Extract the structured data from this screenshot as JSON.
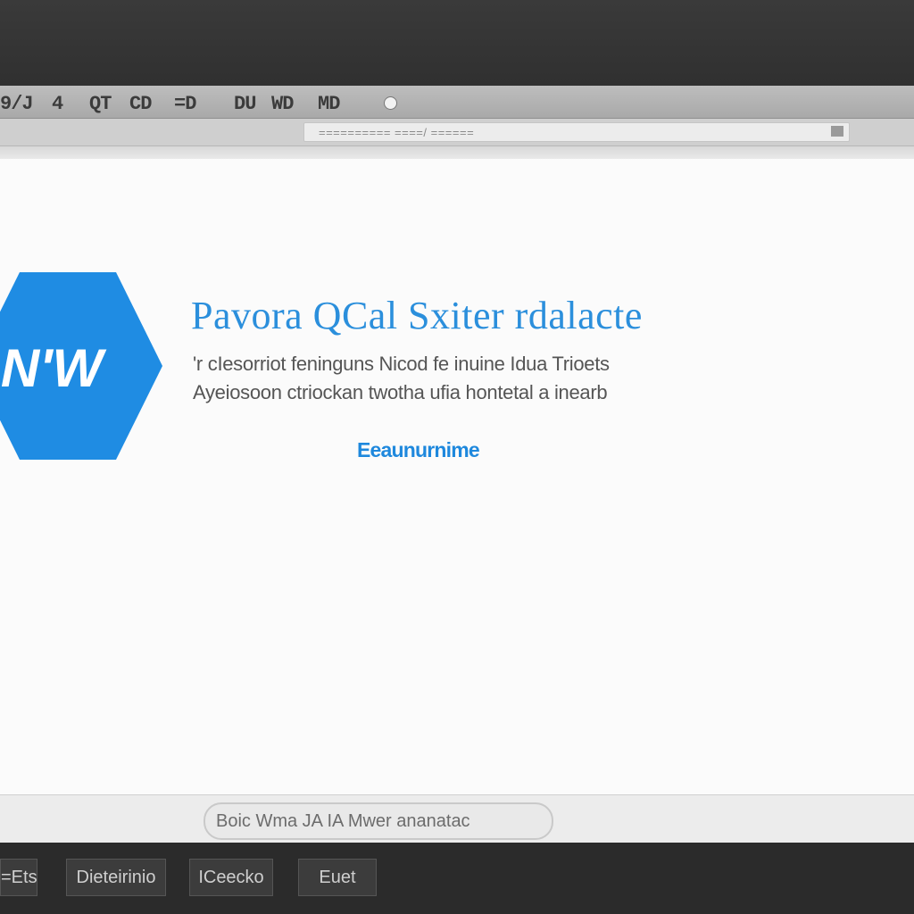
{
  "menubar": {
    "items": [
      "9/J",
      "4",
      "QT",
      "CD",
      "=D",
      "DU",
      "WD",
      "MD"
    ]
  },
  "address": {
    "text": "==========  ====/  ======"
  },
  "product": {
    "title": "Pavora QCal Sxiter rdalacte",
    "desc_line1": "'r cIesorriot feninguns Nicod fe inuine Idua Trioets",
    "desc_line2": "Ayeiosoon ctriockan twotha ufia hontetal a inearb",
    "link": "Eeaunurnime"
  },
  "status": {
    "text": "Boic  Wma JA  IA  Mwer ananatac"
  },
  "taskbar": {
    "buttons": [
      "=Ets",
      "Dieteirinio",
      "ICeecko",
      "Euet"
    ]
  },
  "colors": {
    "accent": "#1e88dd",
    "logo_fill": "#1f8ce3"
  },
  "icons": {
    "logo": "hexagon-logo-icon",
    "address": "page-icon",
    "menu_dot": "circle-icon"
  }
}
